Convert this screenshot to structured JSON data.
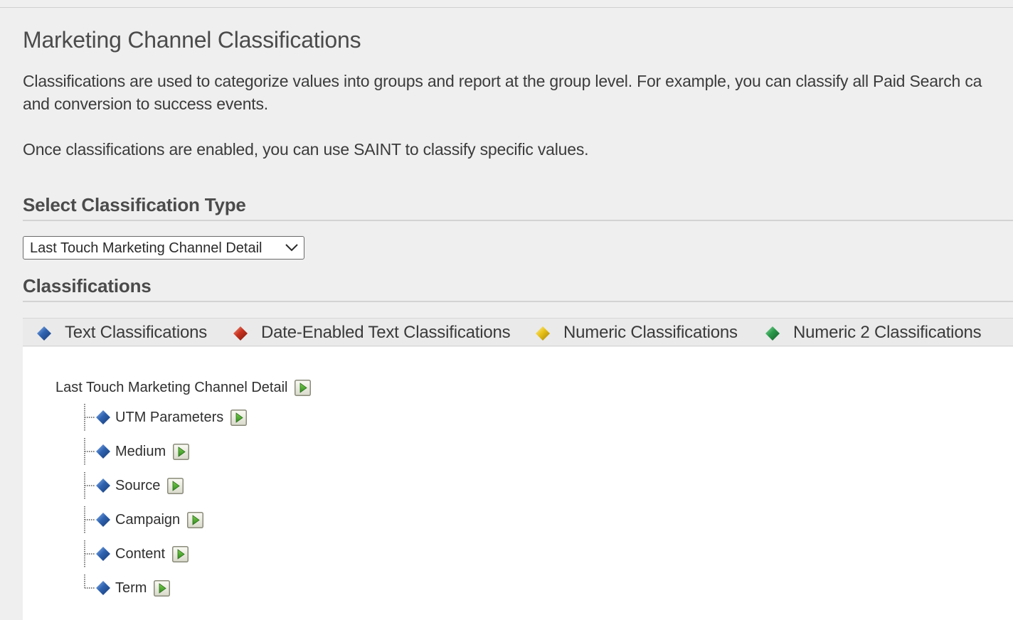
{
  "page": {
    "title": "Marketing Channel Classifications",
    "description_line1": "Classifications are used to categorize values into groups and report at the group level. For example, you can classify all Paid Search ca",
    "description_line2": "and conversion to success events.",
    "description_saint": "Once classifications are enabled, you can use SAINT to classify specific values."
  },
  "classification_type": {
    "heading": "Select Classification Type",
    "selected_value": "Last Touch Marketing Channel Detail"
  },
  "classifications": {
    "heading": "Classifications",
    "legend": [
      {
        "label": "Text Classifications",
        "icon": "blue-gem-icon",
        "color": "#2f63b0"
      },
      {
        "label": "Date-Enabled Text Classifications",
        "icon": "red-gem-icon",
        "color": "#c8321e"
      },
      {
        "label": "Numeric Classifications",
        "icon": "yellow-gem-icon",
        "color": "#e8c21a"
      },
      {
        "label": "Numeric 2 Classifications",
        "icon": "green-gem-icon",
        "color": "#2a9a4a"
      }
    ],
    "tree": {
      "root_label": "Last Touch Marketing Channel Detail",
      "children": [
        {
          "label": "UTM Parameters",
          "type": "text"
        },
        {
          "label": "Medium",
          "type": "text"
        },
        {
          "label": "Source",
          "type": "text"
        },
        {
          "label": "Campaign",
          "type": "text"
        },
        {
          "label": "Content",
          "type": "text"
        },
        {
          "label": "Term",
          "type": "text"
        }
      ]
    }
  }
}
